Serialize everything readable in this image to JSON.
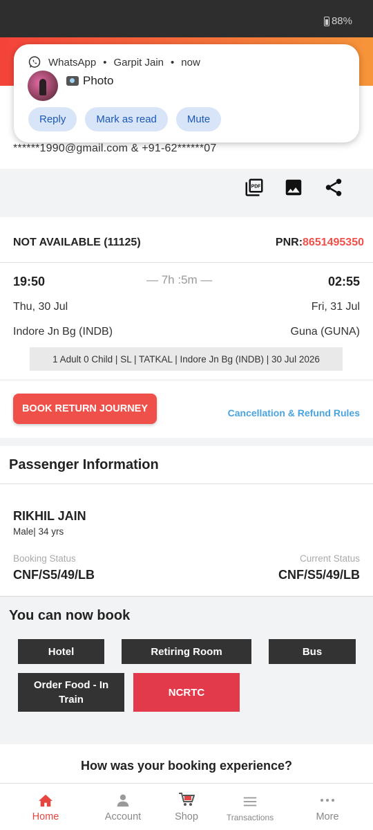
{
  "status_bar": {
    "battery": "88%"
  },
  "notification": {
    "app": "WhatsApp",
    "sender": "Garpit Jain",
    "time": "now",
    "message": "Photo",
    "actions": [
      "Reply",
      "Mark as read",
      "Mute"
    ]
  },
  "contact": {
    "text": "******1990@gmail.com & +91-62******07"
  },
  "train": {
    "status": "NOT AVAILABLE",
    "train_no": "(11125)",
    "pnr_label": "PNR:",
    "pnr": "8651495350",
    "departure_time": "19:50",
    "arrival_time": "02:55",
    "duration": "— 7h :5m —",
    "departure_date": "Thu, 30 Jul",
    "arrival_date": "Fri, 31 Jul",
    "from_station": "Indore Jn Bg (INDB)",
    "to_station": "Guna (GUNA)",
    "summary": "1 Adult 0 Child | SL | TATKAL | Indore Jn Bg (INDB) | 30 Jul 2026"
  },
  "actions": {
    "book_return": "BOOK RETURN JOURNEY",
    "cancellation": "Cancellation & Refund Rules"
  },
  "passenger": {
    "heading": "Passenger Information",
    "name": "RIKHIL JAIN",
    "meta": "Male| 34 yrs",
    "booking_status_label": "Booking Status",
    "current_status_label": "Current Status",
    "booking_status": "CNF/S5/49/LB",
    "current_status": "CNF/S5/49/LB"
  },
  "can_book": {
    "heading": "You can now book",
    "services": [
      "Hotel",
      "Retiring Room",
      "Bus",
      "Order Food - In Train",
      "NCRTC"
    ]
  },
  "feedback": {
    "question": "How was your booking experience?"
  },
  "nav": {
    "items": [
      "Home",
      "Account",
      "Shop",
      "Transactions",
      "More"
    ]
  },
  "colors": {
    "accent": "#f0504a",
    "link": "#4aa3df",
    "ncrtc": "#e23a4b"
  }
}
